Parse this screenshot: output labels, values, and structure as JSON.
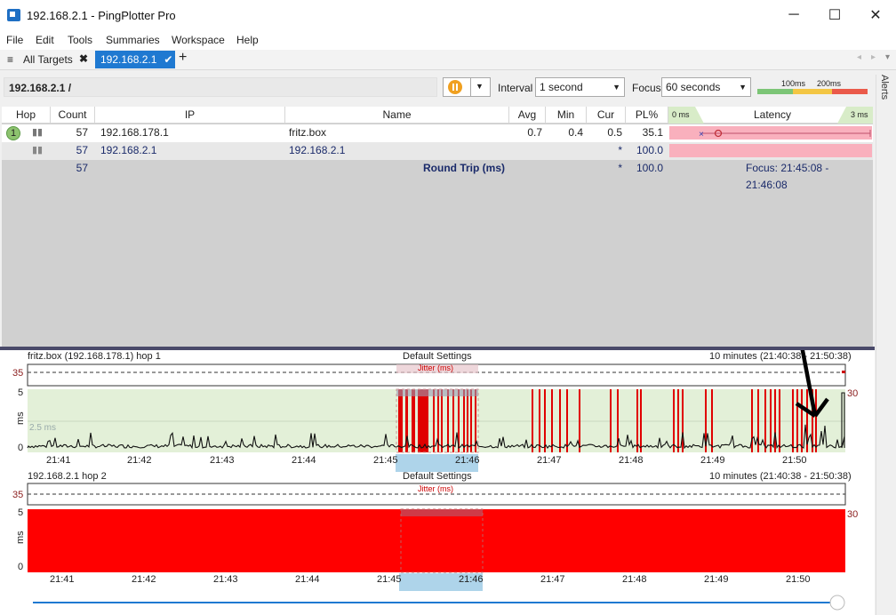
{
  "window": {
    "title": "192.168.2.1 - PingPlotter Pro",
    "minimize": "─",
    "maximize": "☐",
    "close": "✕"
  },
  "menu": [
    "File",
    "Edit",
    "Tools",
    "Summaries",
    "Workspace",
    "Help"
  ],
  "tabs": {
    "all_targets": "All Targets",
    "active": "192.168.2.1",
    "add": "+"
  },
  "toolbar": {
    "path": "192.168.2.1 /",
    "interval_label": "Interval",
    "interval_value": "1 second",
    "focus_label": "Focus",
    "focus_value": "60 seconds",
    "scale": {
      "a": "100ms",
      "b": "200ms"
    }
  },
  "columns": {
    "hop": "Hop",
    "count": "Count",
    "ip": "IP",
    "name": "Name",
    "avg": "Avg",
    "min": "Min",
    "cur": "Cur",
    "pl": "PL%",
    "latency": "Latency",
    "lat_min": "0 ms",
    "lat_max": "3 ms"
  },
  "rows": [
    {
      "hop": "1",
      "count": "57",
      "ip": "192.168.178.1",
      "name": "fritz.box",
      "avg": "0.7",
      "min": "0.4",
      "cur": "0.5",
      "pl": "35.1"
    },
    {
      "hop": "",
      "count": "57",
      "ip": "192.168.2.1",
      "name": "192.168.2.1",
      "avg": "",
      "min": "",
      "cur": "*",
      "pl": "100.0"
    }
  ],
  "summary": {
    "count": "57",
    "label": "Round Trip (ms)",
    "cur": "*",
    "pl": "100.0",
    "focus": "Focus: 21:45:08 - 21:46:08"
  },
  "graph1": {
    "title_left": "fritz.box (192.168.178.1) hop 1",
    "title_center": "Default Settings",
    "title_right": "10 minutes (21:40:38 - 21:50:38)",
    "jitter": "Jitter (ms)",
    "y_jitter": "35",
    "y_top": "5",
    "y_bottom": "0",
    "y_unit": "ms",
    "mid_label": "2.5 ms",
    "loss_scale": "30"
  },
  "graph2": {
    "title_left": "192.168.2.1 hop 2",
    "title_center": "Default Settings",
    "title_right": "10 minutes (21:40:38 - 21:50:38)",
    "jitter": "Jitter (ms)",
    "y_jitter": "35",
    "y_top": "5",
    "y_bottom": "0",
    "y_unit": "ms",
    "loss_scale": "30"
  },
  "time_ticks": [
    "21:41",
    "21:42",
    "21:43",
    "21:44",
    "21:45",
    "21:46",
    "21:47",
    "21:48",
    "21:49",
    "21:50"
  ],
  "alerts": "Alerts",
  "colors": {
    "accent": "#1f79d1",
    "loss": "#ff0000",
    "chart_bg": "#e3f0d8",
    "focus": "#aed4ea"
  }
}
